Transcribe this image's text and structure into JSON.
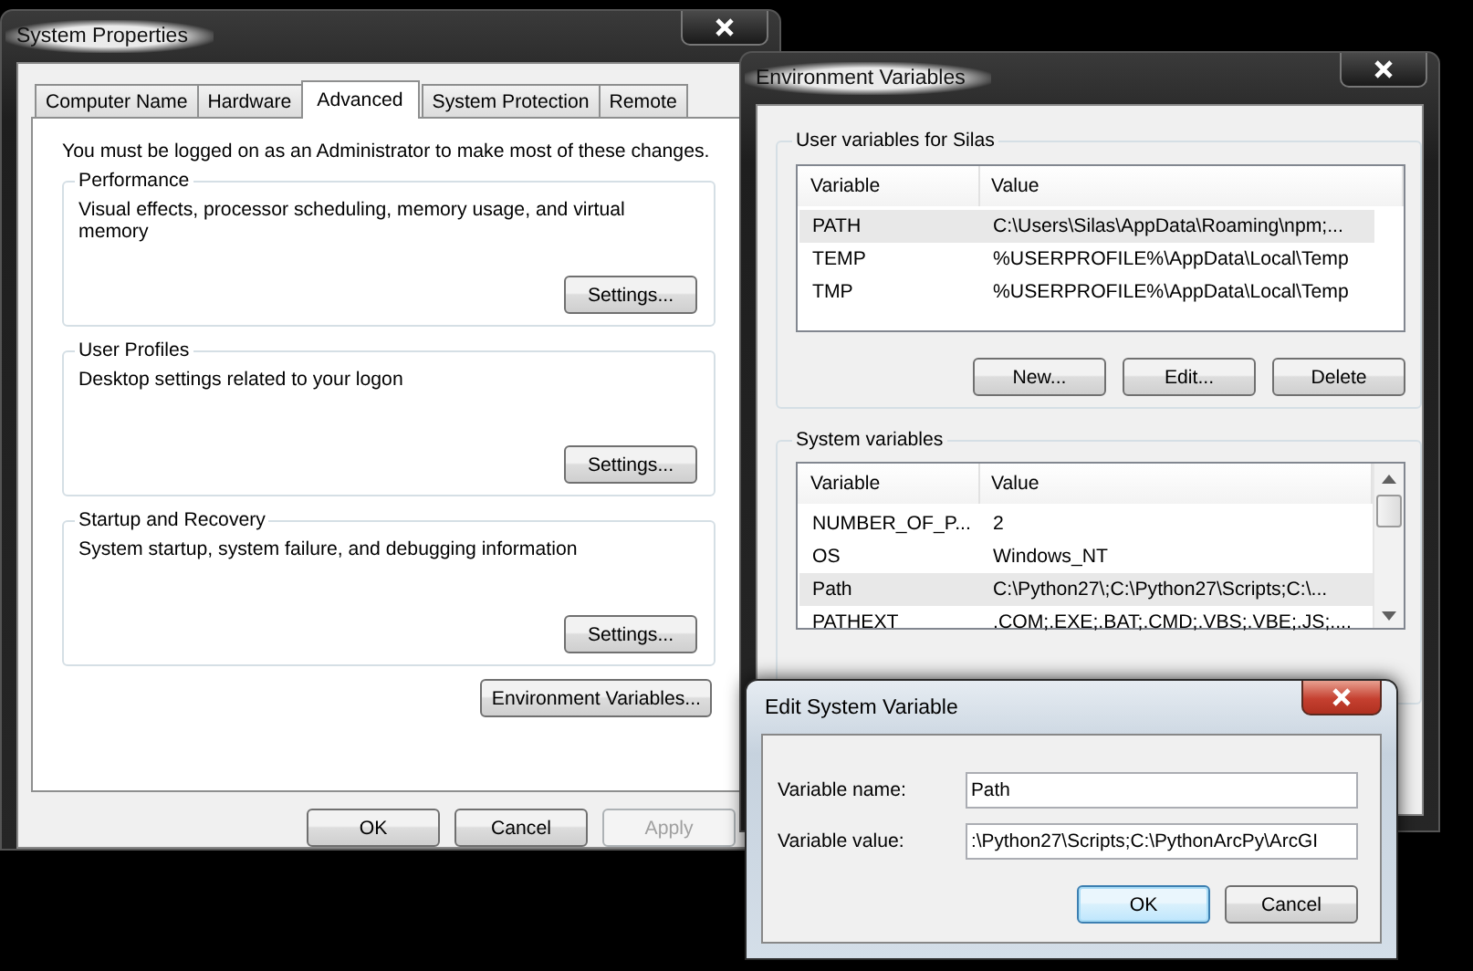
{
  "system_properties": {
    "title": "System Properties",
    "tabs": [
      {
        "label": "Computer Name",
        "selected": false
      },
      {
        "label": "Hardware",
        "selected": false
      },
      {
        "label": "Advanced",
        "selected": true
      },
      {
        "label": "System Protection",
        "selected": false
      },
      {
        "label": "Remote",
        "selected": false
      }
    ],
    "admin_note": "You must be logged on as an Administrator to make most of these changes.",
    "groups": [
      {
        "title": "Performance",
        "description": "Visual effects, processor scheduling, memory usage, and virtual memory",
        "button": "Settings..."
      },
      {
        "title": "User Profiles",
        "description": "Desktop settings related to your logon",
        "button": "Settings..."
      },
      {
        "title": "Startup and Recovery",
        "description": "System startup, system failure, and debugging information",
        "button": "Settings..."
      }
    ],
    "env_button": "Environment Variables...",
    "buttons": [
      {
        "label": "OK",
        "disabled": false
      },
      {
        "label": "Cancel",
        "disabled": false
      },
      {
        "label": "Apply",
        "disabled": true
      }
    ]
  },
  "environment_variables": {
    "title": "Environment Variables",
    "user_group": {
      "title": "User variables for Silas",
      "columns": [
        "Variable",
        "Value"
      ],
      "rows": [
        {
          "variable": "PATH",
          "value": "C:\\Users\\Silas\\AppData\\Roaming\\npm;...",
          "selected": true
        },
        {
          "variable": "TEMP",
          "value": "%USERPROFILE%\\AppData\\Local\\Temp",
          "selected": false
        },
        {
          "variable": "TMP",
          "value": "%USERPROFILE%\\AppData\\Local\\Temp",
          "selected": false
        }
      ],
      "buttons": [
        "New...",
        "Edit...",
        "Delete"
      ]
    },
    "system_group": {
      "title": "System variables",
      "columns": [
        "Variable",
        "Value"
      ],
      "rows": [
        {
          "variable": "NUMBER_OF_P...",
          "value": "2",
          "selected": false
        },
        {
          "variable": "OS",
          "value": "Windows_NT",
          "selected": false
        },
        {
          "variable": "Path",
          "value": "C:\\Python27\\;C:\\Python27\\Scripts;C:\\...",
          "selected": true
        },
        {
          "variable": "PATHEXT",
          "value": ".COM;.EXE;.BAT;.CMD;.VBS;.VBE;.JS;....",
          "selected": false
        }
      ]
    }
  },
  "edit_variable": {
    "title": "Edit System Variable",
    "fields": [
      {
        "label": "Variable name:",
        "value": "Path"
      },
      {
        "label": "Variable value:",
        "value": ":\\Python27\\Scripts;C:\\PythonArcPy\\ArcGI"
      }
    ],
    "buttons": [
      {
        "label": "OK",
        "default": true
      },
      {
        "label": "Cancel",
        "default": false
      }
    ]
  }
}
